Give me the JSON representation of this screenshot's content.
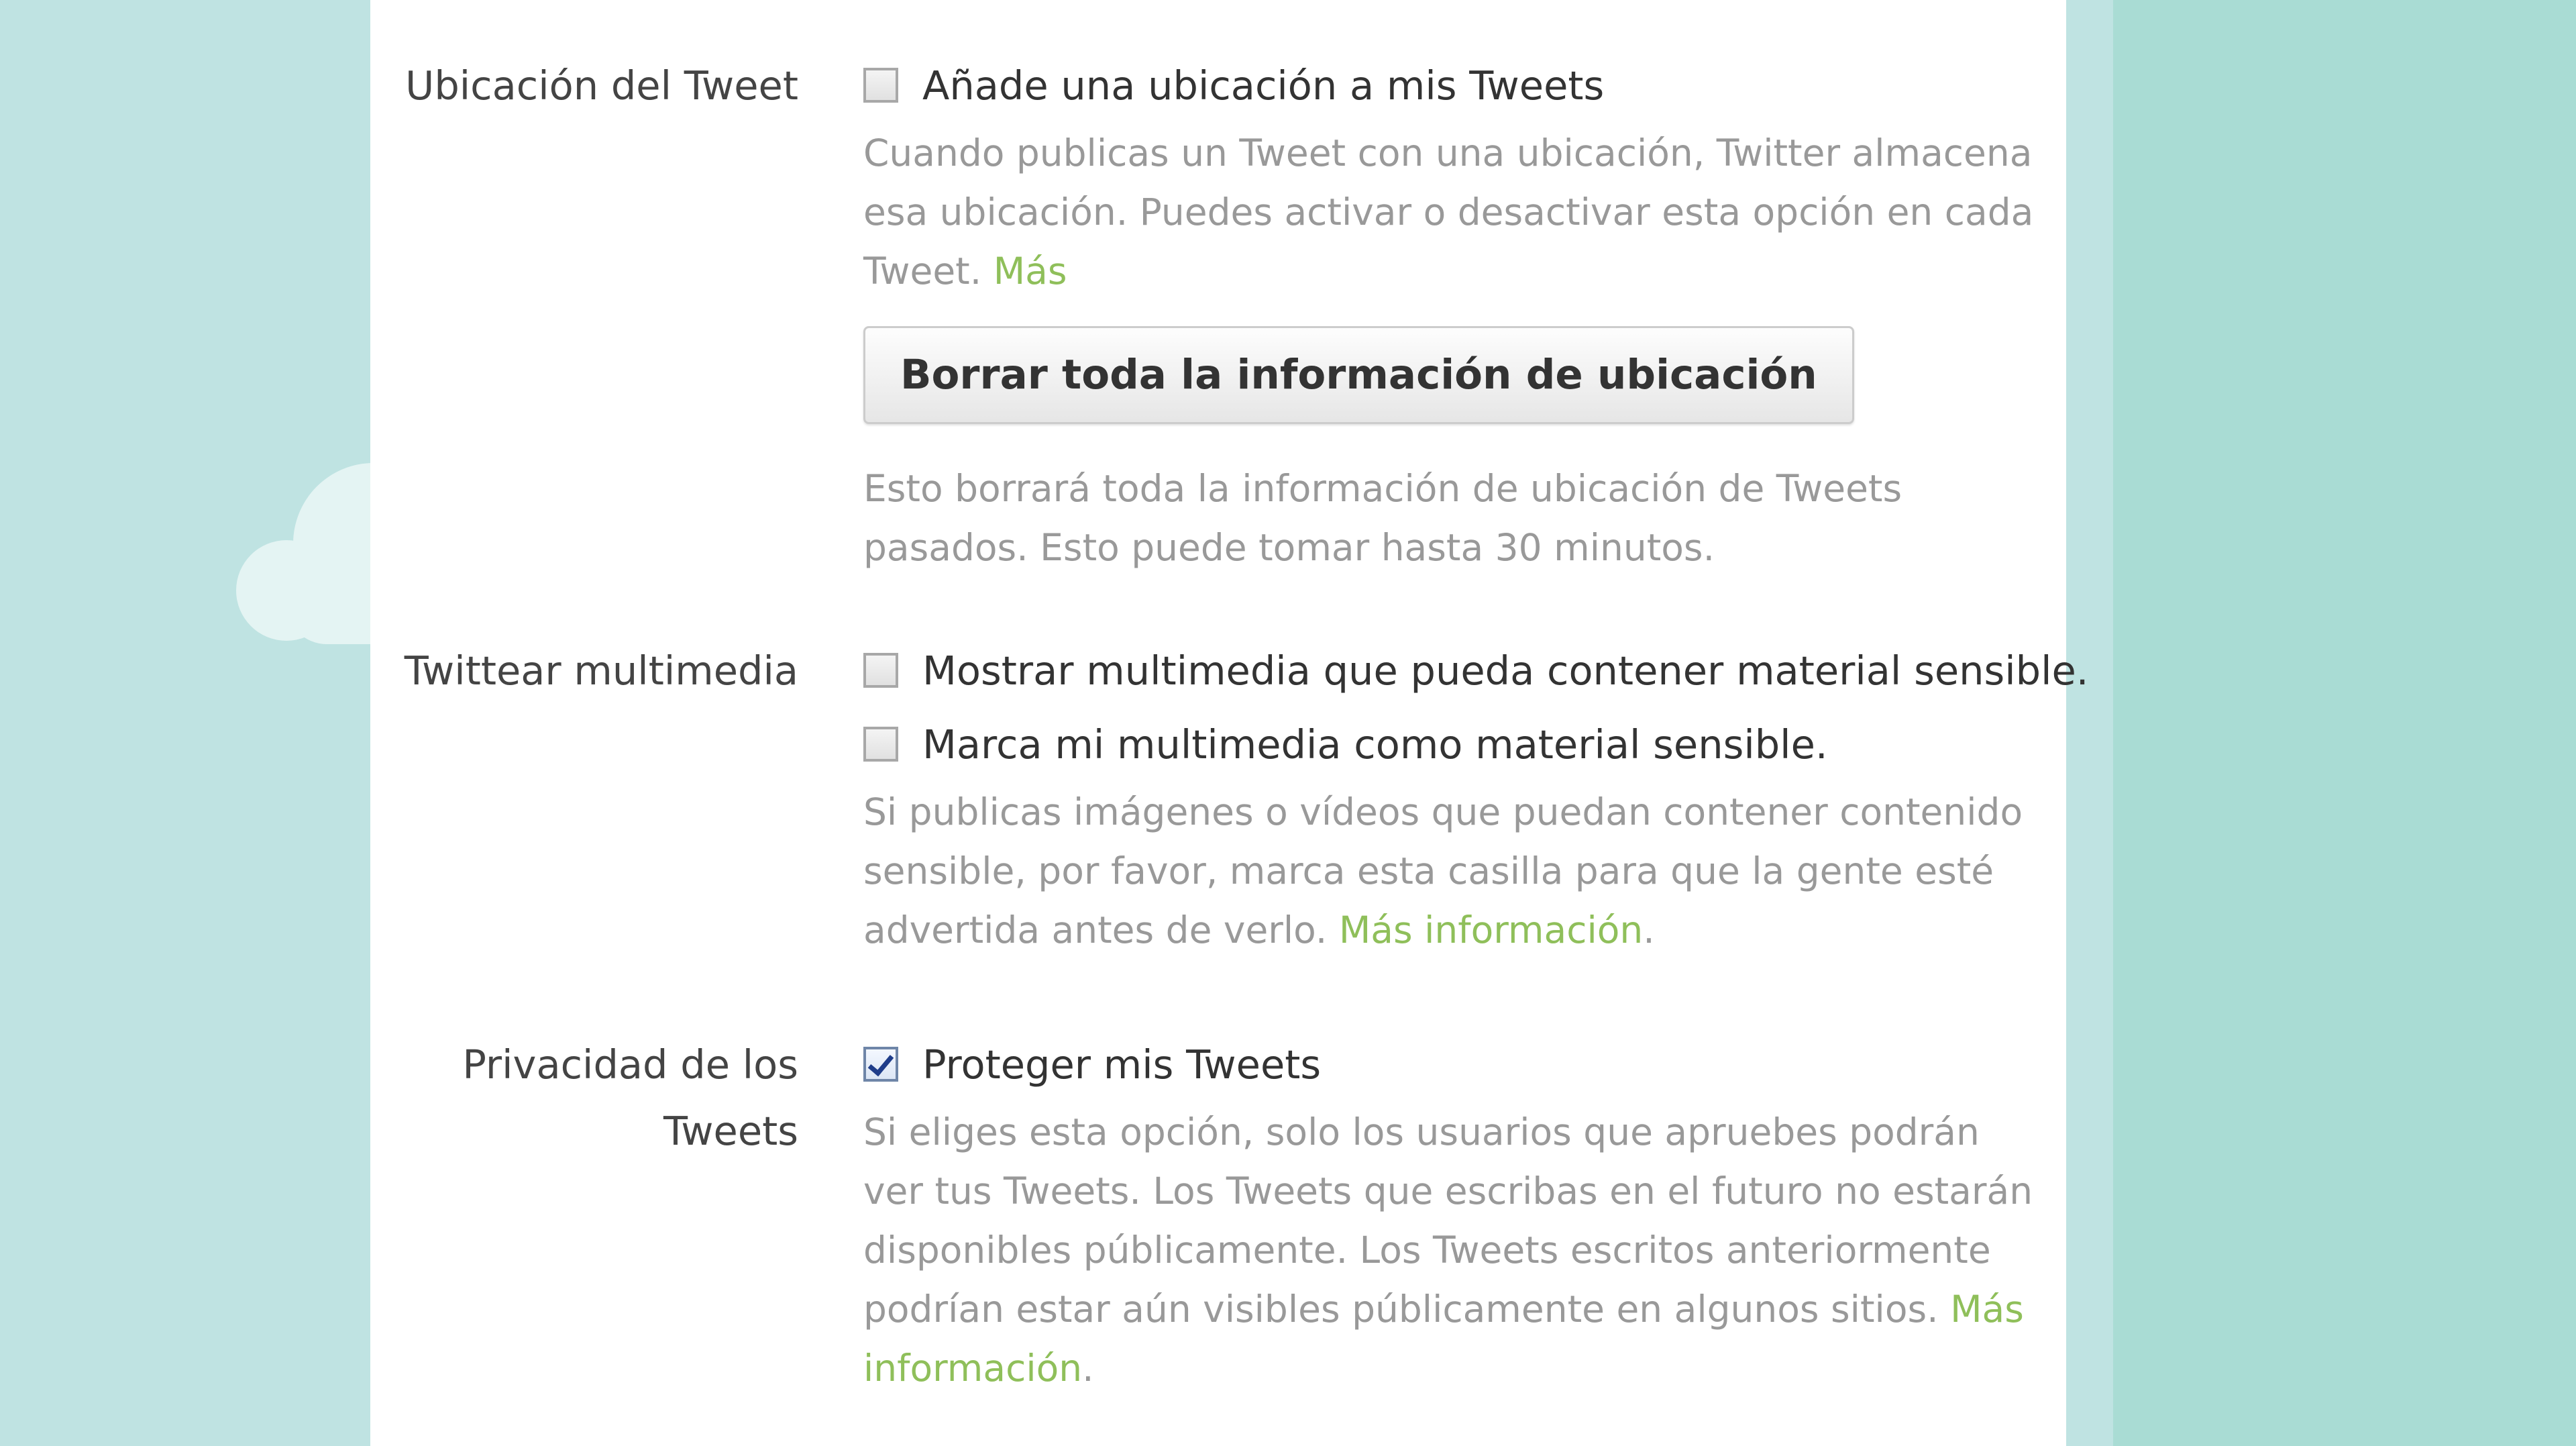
{
  "location": {
    "label": "Ubicación del Tweet",
    "checkbox_label": "Añade una ubicación a mis Tweets",
    "checkbox_checked": false,
    "help_lines": [
      "Cuando publicas un Tweet con una ubicación, Twitter almacena",
      "esa ubicación. Puedes activar o desactivar esta opción en cada"
    ],
    "help_tail": "Tweet.",
    "more_link": "Más",
    "delete_button": "Borrar toda la información de ubicación",
    "delete_help_lines": [
      "Esto borrará toda la información de ubicación de Tweets",
      "pasados. Esto puede tomar hasta 30 minutos."
    ]
  },
  "media": {
    "label": "Twittear multimedia",
    "show_sensitive_label": "Mostrar multimedia que pueda contener material sensible.",
    "show_sensitive_checked": false,
    "mark_sensitive_label": "Marca mi multimedia como material sensible.",
    "mark_sensitive_checked": false,
    "help_lines": [
      "Si publicas imágenes o vídeos que puedan contener contenido",
      "sensible, por favor, marca esta casilla para que la gente esté"
    ],
    "help_tail": "advertida antes de verlo.",
    "more_link": "Más información",
    "help_end": "."
  },
  "privacy": {
    "label_line1": "Privacidad de los",
    "label_line2": "Tweets",
    "checkbox_label": "Proteger mis Tweets",
    "checkbox_checked": true,
    "help_lines": [
      "Si eliges esta opción, solo los usuarios que apruebes podrán",
      "ver tus Tweets. Los Tweets que escribas en el futuro no estarán",
      "disponibles públicamente. Los Tweets escritos anteriormente"
    ],
    "help_tail": "podrían estar aún visibles públicamente en algunos sitios.",
    "more_link_part1": "Más",
    "more_link_part2": "información",
    "help_end": "."
  },
  "colors": {
    "background": "#bfe3e2",
    "panel": "#ffffff",
    "link": "#8fbf5a",
    "help_text": "#999999",
    "label_text": "#444444"
  }
}
